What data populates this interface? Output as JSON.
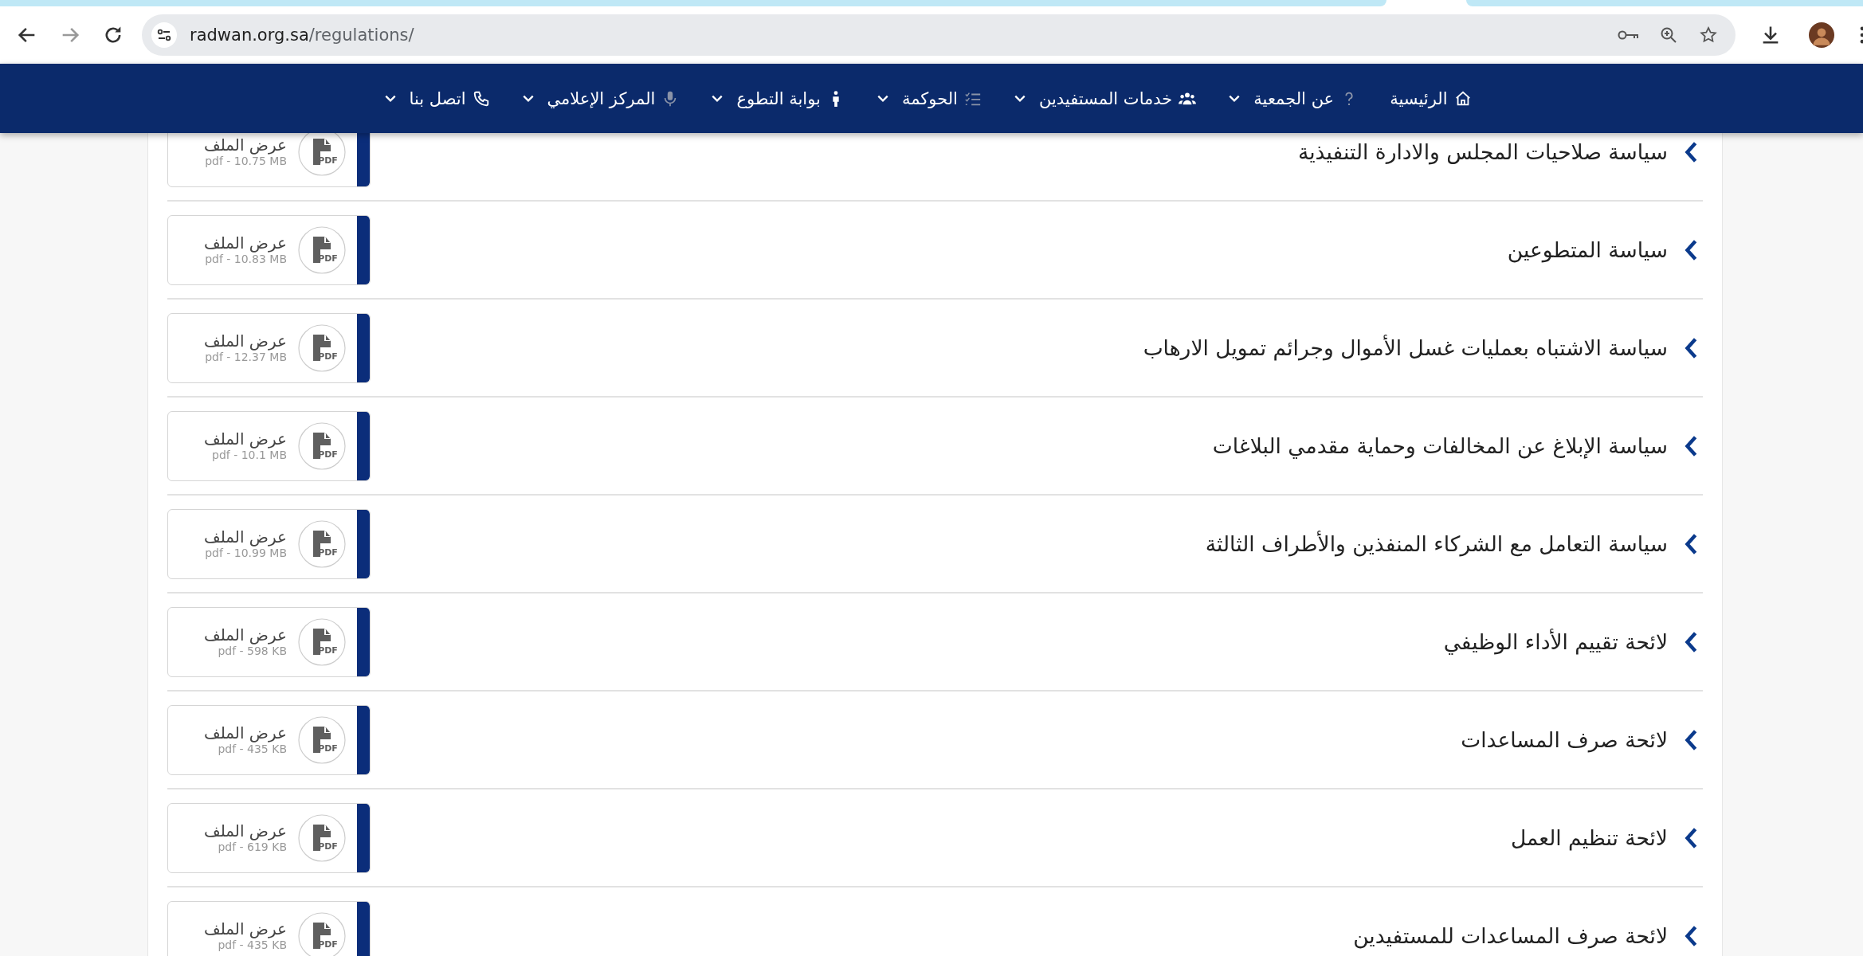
{
  "browser": {
    "url_host": "radwan.org.sa",
    "url_path": "/regulations/"
  },
  "nav": [
    {
      "label": "الرئيسية",
      "dropdown": false
    },
    {
      "label": "عن الجمعية",
      "dropdown": true
    },
    {
      "label": "خدمات المستفيدين",
      "dropdown": true
    },
    {
      "label": "الحوكمة",
      "dropdown": true
    },
    {
      "label": "بوابة التطوع",
      "dropdown": true
    },
    {
      "label": "المركز الإعلامي",
      "dropdown": true
    },
    {
      "label": "اتصل بنا",
      "dropdown": true
    }
  ],
  "documents": [
    {
      "title": "سياسة صلاحيات المجلس والادارة التنفيذية",
      "file_label": "عرض الملف",
      "file_meta": "pdf - 10.75 MB",
      "icon_text": "PDF"
    },
    {
      "title": "سياسة المتطوعين",
      "file_label": "عرض الملف",
      "file_meta": "pdf - 10.83 MB",
      "icon_text": "PDF"
    },
    {
      "title": "سياسة الاشتباه بعمليات غسل الأموال وجرائم تمويل الارهاب",
      "file_label": "عرض الملف",
      "file_meta": "pdf - 12.37 MB",
      "icon_text": "PDF"
    },
    {
      "title": "سياسة الإبلاغ عن المخالفات وحماية مقدمي البلاغات",
      "file_label": "عرض الملف",
      "file_meta": "pdf - 10.1 MB",
      "icon_text": "PDF"
    },
    {
      "title": "سياسة التعامل مع الشركاء المنفذين والأطراف الثالثة",
      "file_label": "عرض الملف",
      "file_meta": "pdf - 10.99 MB",
      "icon_text": "PDF"
    },
    {
      "title": "لائحة تقييم الأداء الوظيفي",
      "file_label": "عرض الملف",
      "file_meta": "pdf - 598 KB",
      "icon_text": "PDF"
    },
    {
      "title": "لائحة صرف المساعدات",
      "file_label": "عرض الملف",
      "file_meta": "pdf - 435 KB",
      "icon_text": "PDF"
    },
    {
      "title": "لائحة تنظيم العمل",
      "file_label": "عرض الملف",
      "file_meta": "pdf - 619 KB",
      "icon_text": "PDF"
    },
    {
      "title": "لائحة صرف المساعدات للمستفيدين",
      "file_label": "عرض الملف",
      "file_meta": "pdf - 435 KB",
      "icon_text": "PDF"
    }
  ]
}
